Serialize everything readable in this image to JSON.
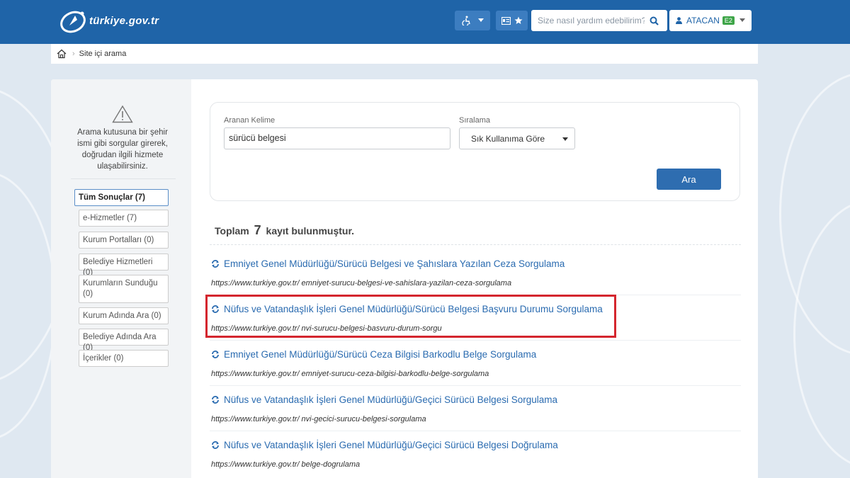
{
  "header": {
    "logo_text": "türkiye.gov.tr",
    "accessibility_icon": "wheelchair-icon",
    "favorites_icon": "star-icon",
    "search_placeholder": "Size nasıl yardım edebilirim?",
    "user_name": "ATACAN",
    "user_badge": "E2",
    "brand_color": "#1f64a8"
  },
  "breadcrumb": {
    "home_icon": "home-icon",
    "current": "Site içi arama"
  },
  "sidebar": {
    "note": "Arama kutusuna bir şehir ismi gibi sorgular girerek, doğrudan ilgili hizmete ulaşabilirsiniz.",
    "filters": [
      {
        "label": "Tüm Sonuçlar (7)",
        "active": true
      },
      {
        "label": "e-Hizmetler (7)"
      },
      {
        "label": "Kurum Portalları (0)"
      },
      {
        "label": "Belediye Hizmetleri (0)"
      },
      {
        "label": "Kurumların Sunduğu (0)"
      },
      {
        "label": "Kurum Adında Ara (0)"
      },
      {
        "label": "Belediye Adında Ara (0)"
      },
      {
        "label": "İçerikler (0)"
      }
    ]
  },
  "search_form": {
    "keyword_label": "Aranan Kelime",
    "keyword_value": "sürücü belgesi",
    "sort_label": "Sıralama",
    "sort_value": "Sık Kullanıma Göre",
    "submit_label": "Ara"
  },
  "results_summary": {
    "prefix": "Toplam",
    "count": "7",
    "suffix": "kayıt bulunmuştur."
  },
  "results": [
    {
      "title": "Emniyet Genel Müdürlüğü/Sürücü Belgesi ve Şahıslara Yazılan Ceza Sorgulama",
      "url": "https://www.turkiye.gov.tr/ emniyet-surucu-belgesi-ve-sahislara-yazilan-ceza-sorgulama"
    },
    {
      "title": "Nüfus ve Vatandaşlık İşleri Genel Müdürlüğü/Sürücü Belgesi Başvuru Durumu Sorgulama",
      "url": "https://www.turkiye.gov.tr/ nvi-surucu-belgesi-basvuru-durum-sorgu",
      "highlighted": true
    },
    {
      "title": "Emniyet Genel Müdürlüğü/Sürücü Ceza Bilgisi Barkodlu Belge Sorgulama",
      "url": "https://www.turkiye.gov.tr/ emniyet-surucu-ceza-bilgisi-barkodlu-belge-sorgulama"
    },
    {
      "title": "Nüfus ve Vatandaşlık İşleri Genel Müdürlüğü/Geçici Sürücü Belgesi Sorgulama",
      "url": "https://www.turkiye.gov.tr/ nvi-gecici-surucu-belgesi-sorgulama"
    },
    {
      "title": "Nüfus ve Vatandaşlık İşleri Genel Müdürlüğü/Geçici Sürücü Belgesi Doğrulama",
      "url": "https://www.turkiye.gov.tr/ belge-dogrulama"
    }
  ],
  "colors": {
    "link": "#2a6bb0",
    "highlight_border": "#d4262e",
    "button": "#2e6db0"
  }
}
